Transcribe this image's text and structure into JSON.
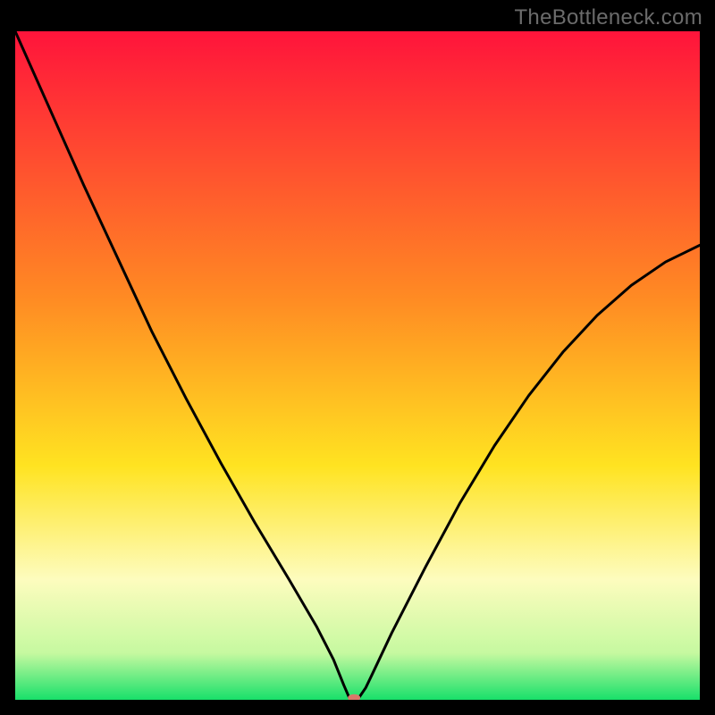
{
  "watermark": "TheBottleneck.com",
  "chart_data": {
    "type": "line",
    "title": "",
    "xlabel": "",
    "ylabel": "",
    "xlim": [
      0,
      100
    ],
    "ylim": [
      0,
      100
    ],
    "grid": false,
    "legend": false,
    "background_gradient": {
      "stops": [
        {
          "offset": 0.0,
          "color": "#ff143b"
        },
        {
          "offset": 0.4,
          "color": "#ff8b23"
        },
        {
          "offset": 0.65,
          "color": "#ffe321"
        },
        {
          "offset": 0.82,
          "color": "#fdfcbe"
        },
        {
          "offset": 0.93,
          "color": "#c6f9a0"
        },
        {
          "offset": 1.0,
          "color": "#18e06a"
        }
      ]
    },
    "notch_curve": {
      "description": "Black V-shaped curve reaching zero near x≈49 with a small flat base; left branch starts at top-left corner, right branch ends around (100,68).",
      "x": [
        0,
        5,
        10,
        15,
        20,
        25,
        30,
        35,
        40,
        44,
        46.5,
        48,
        48.8,
        50.2,
        51.2,
        52,
        55,
        60,
        65,
        70,
        75,
        80,
        85,
        90,
        95,
        100
      ],
      "y": [
        100,
        88.5,
        77,
        66,
        55,
        45,
        35.5,
        26.5,
        18,
        11,
        6,
        2.2,
        0.3,
        0.3,
        1.8,
        3.5,
        10,
        20,
        29.5,
        38,
        45.5,
        52,
        57.5,
        62,
        65.5,
        68
      ],
      "stroke": "#000000",
      "stroke_width": 3
    },
    "marker": {
      "description": "Small rounded salmon marker at the curve minimum",
      "x": 49.5,
      "y": 0.3,
      "color": "#d9786a",
      "rx": 7,
      "ry": 4
    }
  }
}
